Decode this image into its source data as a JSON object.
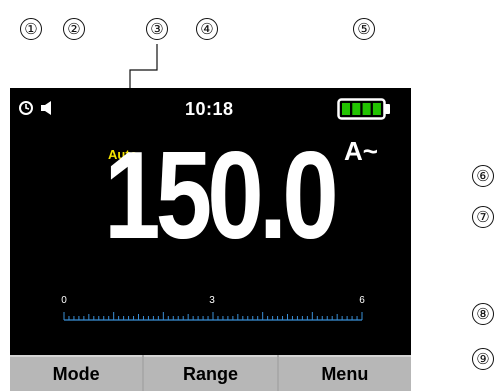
{
  "callouts": [
    "①",
    "②",
    "③",
    "④",
    "⑤",
    "⑥",
    "⑦",
    "⑧",
    "⑨"
  ],
  "status_bar": {
    "timer_icon": "timer-icon",
    "speaker_icon": "speaker-icon",
    "time": "10:18",
    "battery_icon": "battery-full-icon",
    "battery_level": 1.0,
    "battery_color": "#22c300"
  },
  "display": {
    "range_mode": "Auto",
    "range_mode_color": "#f5e400",
    "unit": "A~",
    "reading": "150.0"
  },
  "bar_graph": {
    "scale_labels": [
      "0",
      "3",
      "6"
    ],
    "scale_color": "#3a8fd6"
  },
  "softkeys": [
    "Mode",
    "Range",
    "Menu"
  ]
}
